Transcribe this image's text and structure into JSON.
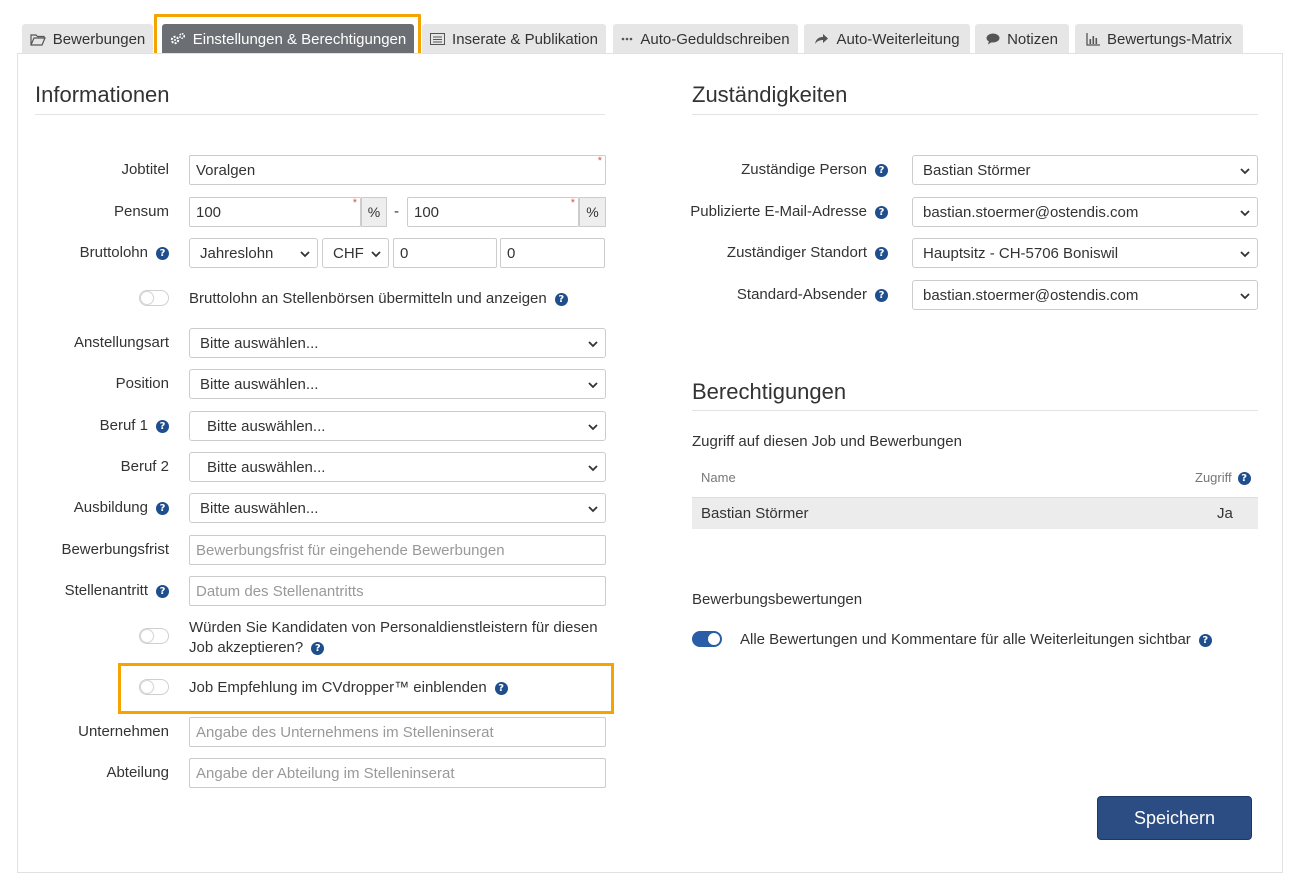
{
  "tabs": [
    {
      "label": "Bewerbungen",
      "icon": "folder-icon",
      "active": false
    },
    {
      "label": "Einstellungen & Berechtigungen",
      "icon": "gears-icon",
      "active": true
    },
    {
      "label": "Inserate & Publikation",
      "icon": "list-icon",
      "active": false
    },
    {
      "label": "Auto-Geduldschreiben",
      "icon": "dots-icon",
      "active": false
    },
    {
      "label": "Auto-Weiterleitung",
      "icon": "share-arrow-icon",
      "active": false
    },
    {
      "label": "Notizen",
      "icon": "comment-icon",
      "active": false
    },
    {
      "label": "Bewertungs-Matrix",
      "icon": "bar-chart-icon",
      "active": false
    }
  ],
  "informationen": {
    "title": "Informationen",
    "jobtitel": {
      "label": "Jobtitel",
      "value": "Voralgen"
    },
    "pensum": {
      "label": "Pensum",
      "from": "100",
      "to": "100",
      "unit": "%",
      "separator": "-"
    },
    "bruttolohn": {
      "label": "Bruttolohn",
      "type": "Jahreslohn",
      "currency": "CHF",
      "from": "0",
      "to": "0"
    },
    "bruttolohn_toggle": {
      "label": "Bruttolohn an Stellenbörsen übermitteln und anzeigen",
      "on": false
    },
    "anstellungsart": {
      "label": "Anstellungsart",
      "value": "Bitte auswählen..."
    },
    "position": {
      "label": "Position",
      "value": "Bitte auswählen..."
    },
    "beruf1": {
      "label": "Beruf 1",
      "value": "Bitte auswählen..."
    },
    "beruf2": {
      "label": "Beruf 2",
      "value": "Bitte auswählen..."
    },
    "ausbildung": {
      "label": "Ausbildung",
      "value": "Bitte auswählen..."
    },
    "bewerbungsfrist": {
      "label": "Bewerbungsfrist",
      "placeholder": "Bewerbungsfrist für eingehende Bewerbungen"
    },
    "stellenantritt": {
      "label": "Stellenantritt",
      "placeholder": "Datum des Stellenantritts"
    },
    "personaldienstleister_toggle": {
      "line1": "Würden Sie Kandidaten von Personaldienstleistern für diesen",
      "line2": "Job akzeptieren?",
      "on": false
    },
    "cvdropper_toggle": {
      "label": "Job Empfehlung im CVdropper™ einblenden",
      "on": false
    },
    "unternehmen": {
      "label": "Unternehmen",
      "placeholder": "Angabe des Unternehmens im Stelleninserat"
    },
    "abteilung": {
      "label": "Abteilung",
      "placeholder": "Angabe der Abteilung im Stelleninserat"
    }
  },
  "zustaendigkeiten": {
    "title": "Zuständigkeiten",
    "person": {
      "label": "Zuständige Person",
      "value": "Bastian Störmer"
    },
    "email": {
      "label": "Publizierte E-Mail-Adresse",
      "value": "bastian.stoermer@ostendis.com"
    },
    "standort": {
      "label": "Zuständiger Standort",
      "value": "Hauptsitz - CH-5706 Boniswil"
    },
    "absender": {
      "label": "Standard-Absender",
      "value": "bastian.stoermer@ostendis.com"
    }
  },
  "berechtigungen": {
    "title": "Berechtigungen",
    "subtitle": "Zugriff auf diesen Job und Bewerbungen",
    "columns": {
      "name": "Name",
      "zugriff": "Zugriff"
    },
    "rows": [
      {
        "name": "Bastian Störmer",
        "zugriff": "Ja"
      }
    ],
    "bewertungen_title": "Bewerbungsbewertungen",
    "bewertungen_toggle": {
      "label": "Alle Bewertungen und Kommentare für alle Weiterleitungen sichtbar",
      "on": true
    }
  },
  "actions": {
    "save_label": "Speichern"
  },
  "colors": {
    "accent": "#2c4c84",
    "highlight": "#f5a300",
    "active_tab": "#6b6f73",
    "help_icon": "#1f4e8c"
  }
}
